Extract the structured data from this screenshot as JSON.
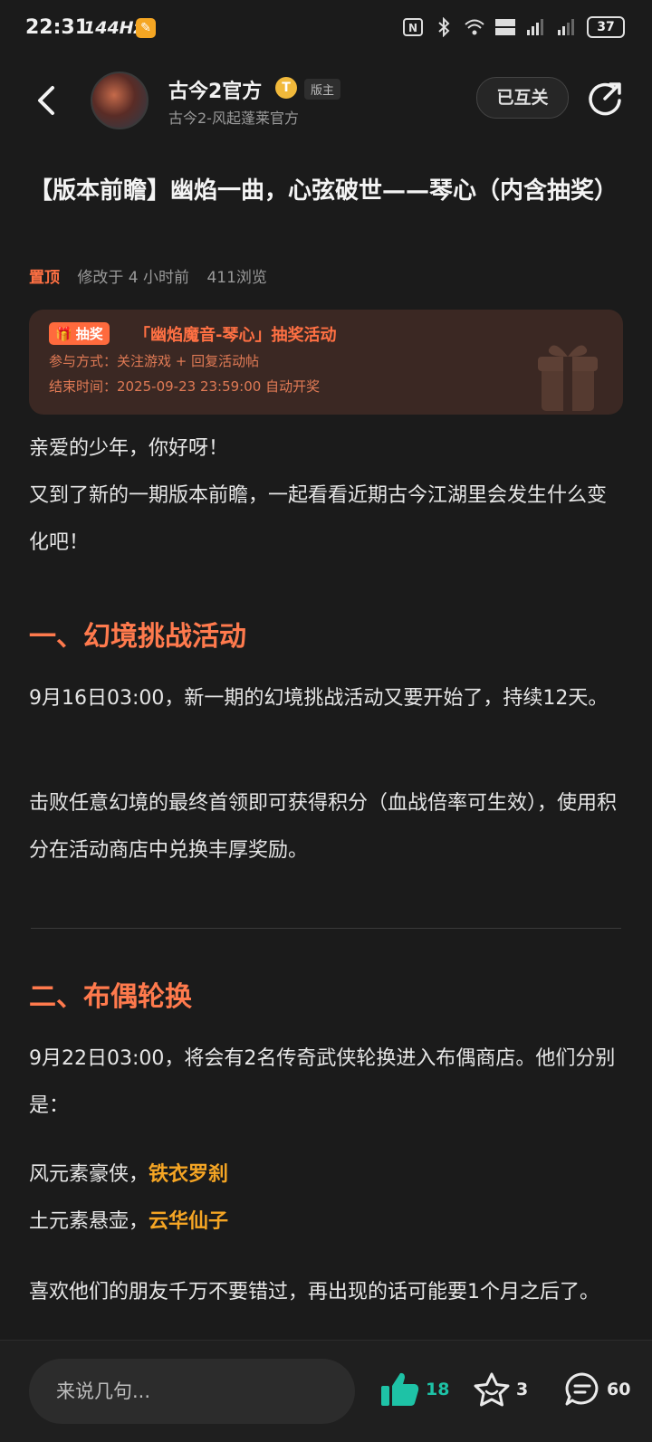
{
  "status_bar": {
    "time": "22:31",
    "refresh_rate": "144Hz",
    "battery": "37"
  },
  "header": {
    "author_name": "古今2官方",
    "vip_badge": "T",
    "moderator_badge": "版主",
    "author_subtitle": "古今2-风起蓬莱官方",
    "follow_label": "已互关"
  },
  "post": {
    "title": "【版本前瞻】幽焰一曲，心弦破世——琴心（内含抽奖）",
    "pinned_label": "置顶",
    "modified": "修改于 4 小时前",
    "views": "411浏览"
  },
  "lottery": {
    "tag": "抽奖",
    "title": "「幽焰魔音-琴心」抽奖活动",
    "participation": "参与方式：关注游戏 + 回复活动帖",
    "end_time": "结束时间：2025-09-23 23:59:00 自动开奖"
  },
  "body": {
    "greeting": "亲爱的少年，你好呀！",
    "intro": "又到了新的一期版本前瞻，一起看看近期古今江湖里会发生什么变化吧！",
    "section1_heading": "一、幻境挑战活动",
    "section1_p1": "9月16日03:00，新一期的幻境挑战活动又要开始了，持续12天。",
    "section1_p2": "击败任意幻境的最终首领即可获得积分（血战倍率可生效），使用积分在活动商店中兑换丰厚奖励。",
    "section2_heading": "二、布偶轮换",
    "section2_p1": "9月22日03:00，将会有2名传奇武侠轮换进入布偶商店。他们分别是：",
    "hero1_prefix": "风元素豪侠，",
    "hero1_name": "铁衣罗刹",
    "hero2_prefix": "土元素悬壶，",
    "hero2_name": "云华仙子",
    "section2_p2": "喜欢他们的朋友千万不要错过，再出现的话可能要1个月之后了。"
  },
  "bottom_bar": {
    "comment_placeholder": "来说几句...",
    "like_count": "18",
    "favorite_count": "3",
    "comment_count": "60"
  },
  "colors": {
    "accent": "#ff7a4d",
    "highlight": "#f5a524",
    "like": "#1ec2a6",
    "background": "#1b1b1b"
  }
}
